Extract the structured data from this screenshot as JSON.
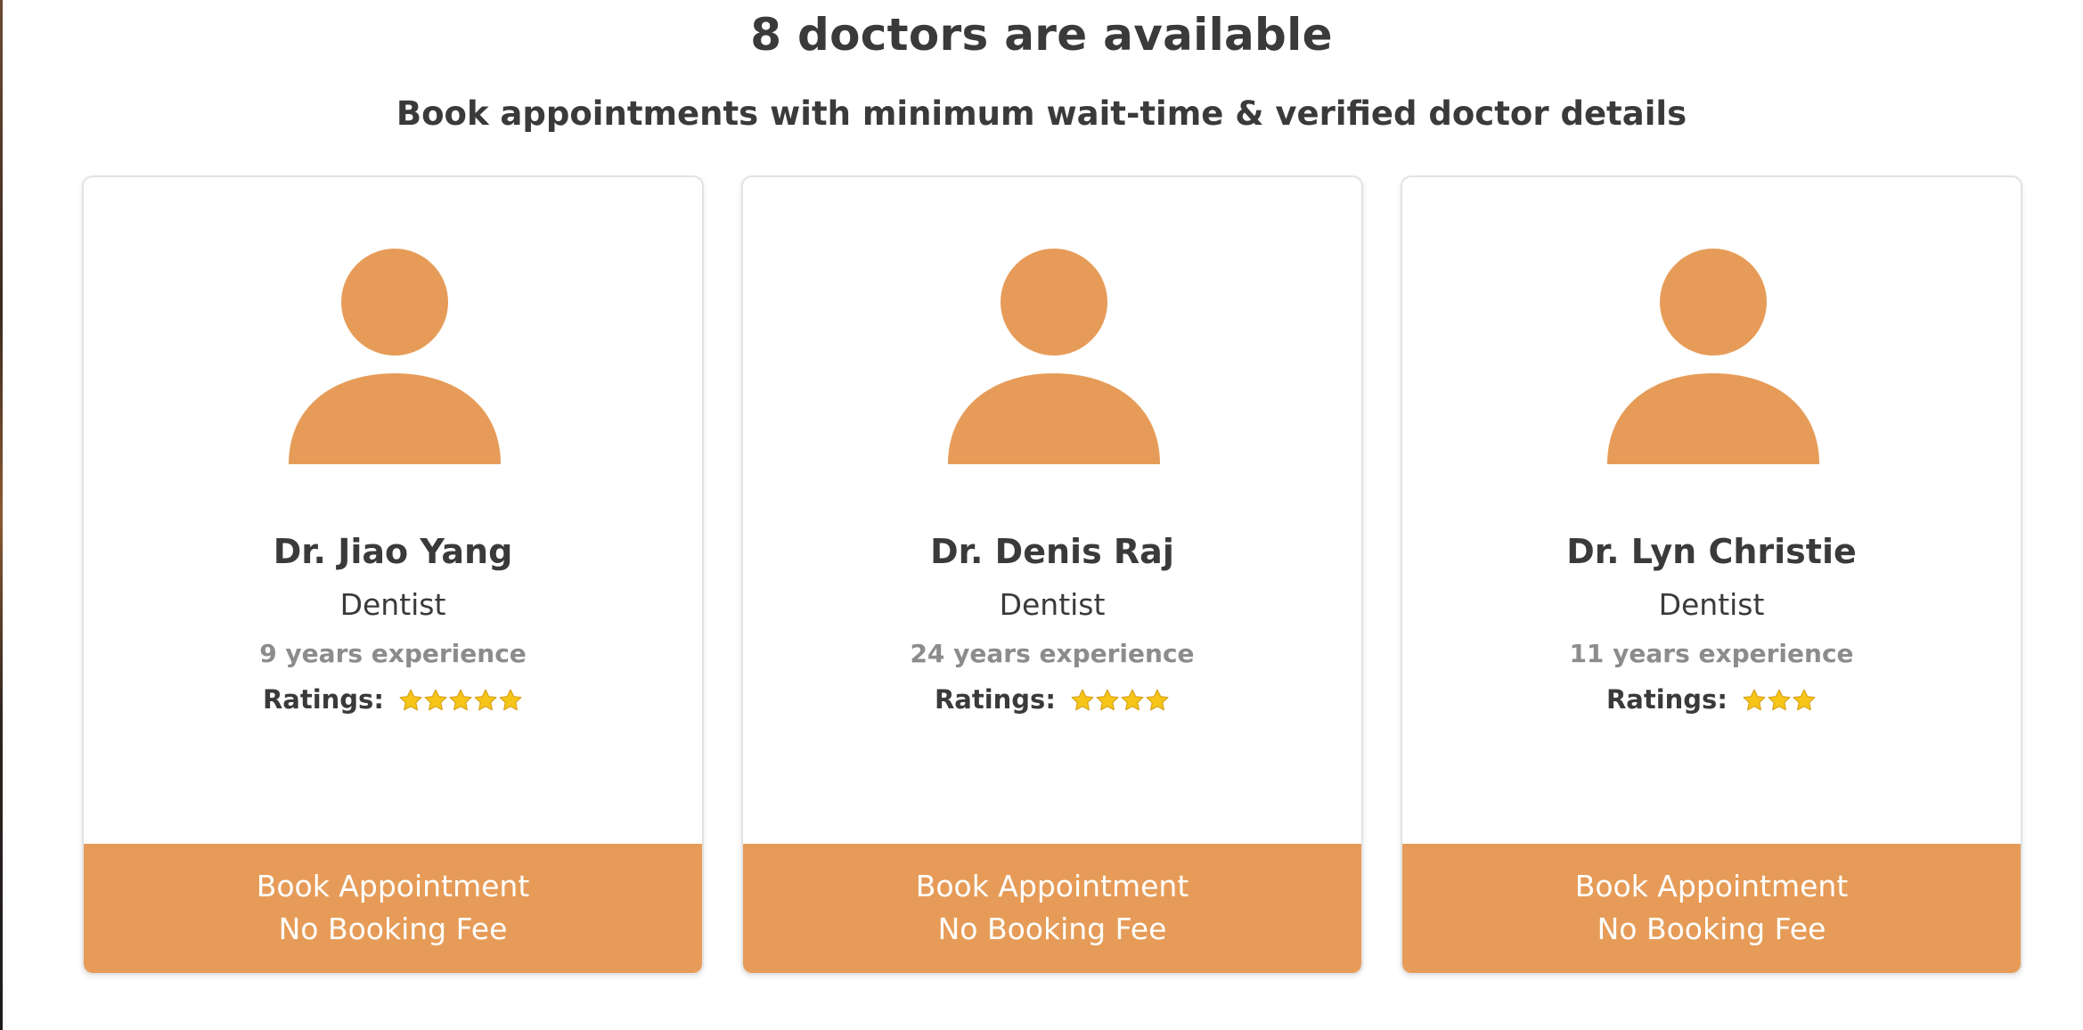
{
  "header": {
    "title": "8 doctors are available",
    "subtitle": "Book appointments with minimum wait-time & verified doctor details"
  },
  "colors": {
    "accent": "#e69c58",
    "text": "#3a3a3a",
    "muted": "#8c8c8c",
    "star": "#f5c518"
  },
  "doctors": [
    {
      "name": "Dr. Jiao Yang",
      "specialty": "Dentist",
      "experience": "9 years experience",
      "ratings_label": "Ratings:",
      "rating": 5,
      "avatar_icon": "person-icon",
      "button_line1": "Book Appointment",
      "button_line2": "No Booking Fee"
    },
    {
      "name": "Dr. Denis Raj",
      "specialty": "Dentist",
      "experience": "24 years experience",
      "ratings_label": "Ratings:",
      "rating": 4,
      "avatar_icon": "person-icon",
      "button_line1": "Book Appointment",
      "button_line2": "No Booking Fee"
    },
    {
      "name": "Dr. Lyn Christie",
      "specialty": "Dentist",
      "experience": "11 years experience",
      "ratings_label": "Ratings:",
      "rating": 3,
      "avatar_icon": "person-icon",
      "button_line1": "Book Appointment",
      "button_line2": "No Booking Fee"
    }
  ]
}
